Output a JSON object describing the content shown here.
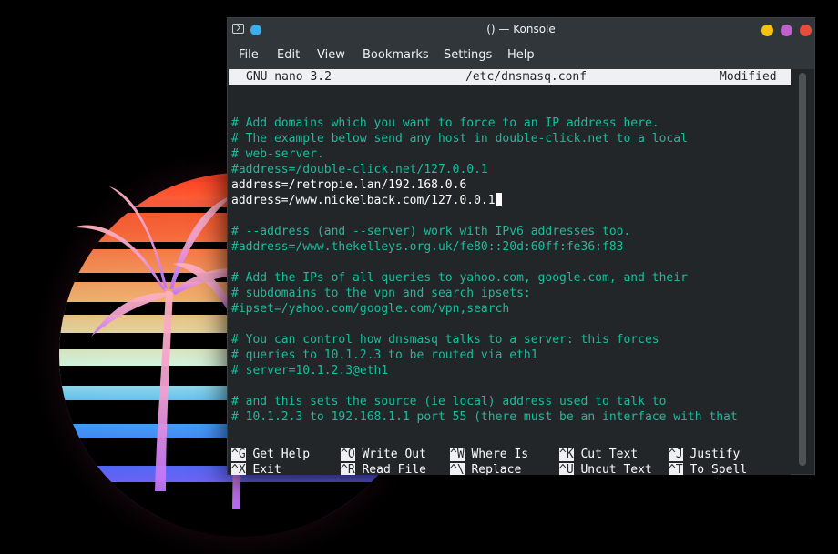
{
  "window": {
    "title": "() — Konsole",
    "controls": {
      "minimize_color": "#f5c211",
      "maximize_color": "#c061cb",
      "close_color": "#e74c3c"
    },
    "accent": "#3daee9"
  },
  "menu": [
    "File",
    "Edit",
    "View",
    "Bookmarks",
    "Settings",
    "Help"
  ],
  "nano": {
    "version": "GNU nano 3.2",
    "filename": "/etc/dnsmasq.conf",
    "status": "Modified",
    "lines": [
      {
        "text": "",
        "type": "plain"
      },
      {
        "text": "",
        "type": "plain"
      },
      {
        "text": "# Add domains which you want to force to an IP address here.",
        "type": "comment"
      },
      {
        "text": "# The example below send any host in double-click.net to a local",
        "type": "comment"
      },
      {
        "text": "# web-server.",
        "type": "comment"
      },
      {
        "text": "#address=/double-click.net/127.0.0.1",
        "type": "comment"
      },
      {
        "text": "address=/retropie.lan/192.168.0.6",
        "type": "plain"
      },
      {
        "text": "address=/www.nickelback.com/127.0.0.1",
        "type": "plain",
        "cursor": true
      },
      {
        "text": "",
        "type": "plain"
      },
      {
        "text": "# --address (and --server) work with IPv6 addresses too.",
        "type": "comment"
      },
      {
        "text": "#address=/www.thekelleys.org.uk/fe80::20d:60ff:fe36:f83",
        "type": "comment"
      },
      {
        "text": "",
        "type": "plain"
      },
      {
        "text": "# Add the IPs of all queries to yahoo.com, google.com, and their",
        "type": "comment"
      },
      {
        "text": "# subdomains to the vpn and search ipsets:",
        "type": "comment"
      },
      {
        "text": "#ipset=/yahoo.com/google.com/vpn,search",
        "type": "comment"
      },
      {
        "text": "",
        "type": "plain"
      },
      {
        "text": "# You can control how dnsmasq talks to a server: this forces",
        "type": "comment"
      },
      {
        "text": "# queries to 10.1.2.3 to be routed via eth1",
        "type": "comment"
      },
      {
        "text": "# server=10.1.2.3@eth1",
        "type": "comment"
      },
      {
        "text": "",
        "type": "plain"
      },
      {
        "text": "# and this sets the source (ie local) address used to talk to",
        "type": "comment"
      },
      {
        "text": "# 10.1.2.3 to 192.168.1.1 port 55 (there must be an interface with that",
        "type": "comment"
      }
    ],
    "shortcuts": [
      [
        {
          "key": "^G",
          "label": "Get Help"
        },
        {
          "key": "^O",
          "label": "Write Out"
        },
        {
          "key": "^W",
          "label": "Where Is"
        },
        {
          "key": "^K",
          "label": "Cut Text"
        },
        {
          "key": "^J",
          "label": "Justify"
        }
      ],
      [
        {
          "key": "^X",
          "label": "Exit"
        },
        {
          "key": "^R",
          "label": "Read File"
        },
        {
          "key": "^\\",
          "label": "Replace"
        },
        {
          "key": "^U",
          "label": "Uncut Text"
        },
        {
          "key": "^T",
          "label": "To Spell"
        }
      ]
    ]
  }
}
